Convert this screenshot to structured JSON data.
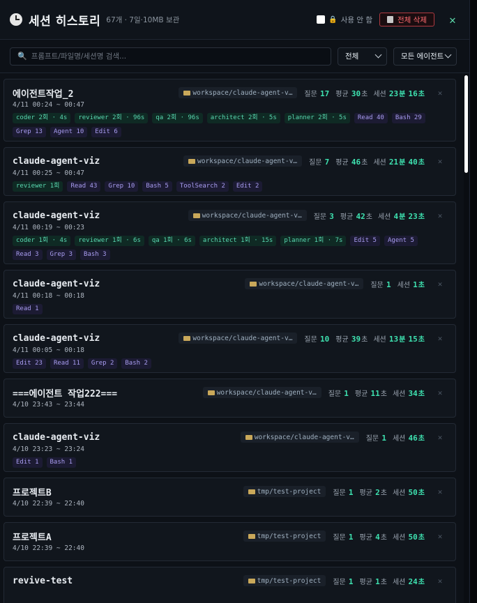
{
  "header": {
    "title": "세션 히스토리",
    "subtitle": "67개 · 7일·10MB 보관",
    "unused_label": "사용 안 함",
    "delete_all_label": "전체 삭제",
    "close_glyph": "✕"
  },
  "toolbar": {
    "search_placeholder": "프롬프트/파일명/세션명 검색...",
    "filter_value": "전체",
    "agent_filter_value": "모든 에이전트"
  },
  "labels": {
    "questions": "질문",
    "avg": "평균",
    "session": "세션",
    "sec": "초",
    "min": "분",
    "remove": "✕"
  },
  "sessions": [
    {
      "name": "에이전트작업_2",
      "path": "workspace/claude-agent-v…",
      "questions": "17",
      "avg": "30",
      "session_min": "23",
      "session_sec": "16",
      "date": "4/11 00:24 ~ 00:47",
      "agents": [
        "coder 2회 · 4s",
        "reviewer 2회 · 96s",
        "qa 2회 · 96s",
        "architect 2회 · 5s",
        "planner 2회 · 5s"
      ],
      "tools": [
        "Read 40",
        "Bash 29",
        "Grep 13",
        "Agent 10",
        "Edit 6"
      ]
    },
    {
      "name": "claude-agent-viz",
      "path": "workspace/claude-agent-v…",
      "questions": "7",
      "avg": "46",
      "session_min": "21",
      "session_sec": "40",
      "date": "4/11 00:25 ~ 00:47",
      "agents": [
        "reviewer 1회"
      ],
      "tools": [
        "Read 43",
        "Grep 10",
        "Bash 5",
        "ToolSearch 2",
        "Edit 2"
      ]
    },
    {
      "name": "claude-agent-viz",
      "path": "workspace/claude-agent-v…",
      "questions": "3",
      "avg": "42",
      "session_min": "4",
      "session_sec": "23",
      "date": "4/11 00:19 ~ 00:23",
      "agents": [
        "coder 1회 · 4s",
        "reviewer 1회 · 6s",
        "qa 1회 · 6s",
        "architect 1회 · 15s",
        "planner 1회 · 7s"
      ],
      "tools": [
        "Edit 5",
        "Agent 5",
        "Read 3",
        "Grep 3",
        "Bash 3"
      ]
    },
    {
      "name": "claude-agent-viz",
      "path": "workspace/claude-agent-v…",
      "questions": "1",
      "avg": "",
      "session_min": "",
      "session_sec": "1",
      "date": "4/11 00:18 ~ 00:18",
      "agents": [],
      "tools": [
        "Read 1"
      ]
    },
    {
      "name": "claude-agent-viz",
      "path": "workspace/claude-agent-v…",
      "questions": "10",
      "avg": "39",
      "session_min": "13",
      "session_sec": "15",
      "date": "4/11 00:05 ~ 00:18",
      "agents": [],
      "tools": [
        "Edit 23",
        "Read 11",
        "Grep 2",
        "Bash 2"
      ]
    },
    {
      "name": "===에이전트 작업222===",
      "path": "workspace/claude-agent-v…",
      "questions": "1",
      "avg": "11",
      "session_min": "",
      "session_sec": "34",
      "date": "4/10 23:43 ~ 23:44",
      "agents": [],
      "tools": []
    },
    {
      "name": "claude-agent-viz",
      "path": "workspace/claude-agent-v…",
      "questions": "1",
      "avg": "",
      "session_min": "",
      "session_sec": "46",
      "date": "4/10 23:23 ~ 23:24",
      "agents": [],
      "tools": [
        "Edit 1",
        "Bash 1"
      ]
    },
    {
      "name": "프로젝트B",
      "path": "tmp/test-project",
      "questions": "1",
      "avg": "2",
      "session_min": "",
      "session_sec": "50",
      "date": "4/10 22:39 ~ 22:40",
      "agents": [],
      "tools": []
    },
    {
      "name": "프로젝트A",
      "path": "tmp/test-project",
      "questions": "1",
      "avg": "4",
      "session_min": "",
      "session_sec": "50",
      "date": "4/10 22:39 ~ 22:40",
      "agents": [],
      "tools": []
    },
    {
      "name": "revive-test",
      "path": "tmp/test-project",
      "questions": "1",
      "avg": "1",
      "session_min": "",
      "session_sec": "24",
      "date": "",
      "agents": [],
      "tools": []
    }
  ],
  "colors": {
    "accent": "#3ee2b0",
    "danger": "#ff6b70",
    "agent_tag": "#59d8b0",
    "tool_tag": "#a89cf0"
  },
  "icons": {
    "header": "clock-icon",
    "lock": "lock-icon",
    "trash": "trash-icon",
    "search": "search-icon",
    "folder": "folder-icon"
  }
}
